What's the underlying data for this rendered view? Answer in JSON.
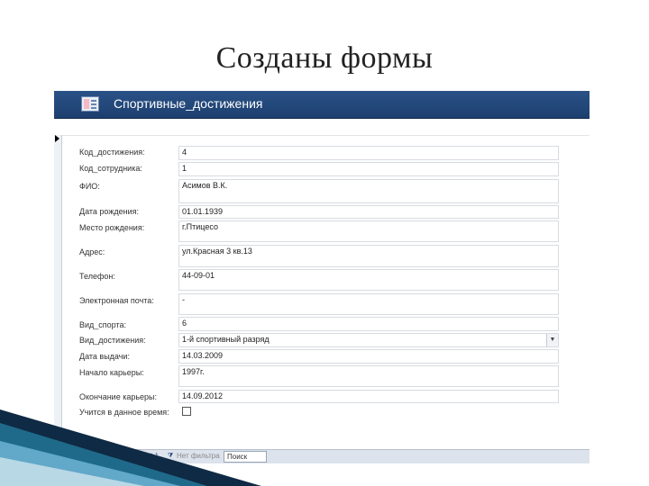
{
  "slide": {
    "title": "Созданы формы"
  },
  "form": {
    "title": "Спортивные_достижения"
  },
  "fields": [
    {
      "label": "Код_достижения:",
      "value": "4"
    },
    {
      "label": "Код_сотрудника:",
      "value": "1"
    },
    {
      "label": "ФИО:",
      "value": "Асимов В.К."
    },
    {
      "label": "Дата рождения:",
      "value": "01.01.1939"
    },
    {
      "label": "Место рождения:",
      "value": "г.Птицесо"
    },
    {
      "label": "Адрес:",
      "value": "ул.Красная 3 кв.13"
    },
    {
      "label": "Телефон:",
      "value": "44-09-01"
    },
    {
      "label": "Электронная почта:",
      "value": "-"
    },
    {
      "label": "Вид_спорта:",
      "value": "6"
    },
    {
      "label": "Вид_достижения:",
      "value": "1-й спортивный разряд"
    },
    {
      "label": "Дата выдачи:",
      "value": "14.03.2009"
    },
    {
      "label": "Начало карьеры:",
      "value": "1997г."
    },
    {
      "label": "Окончание карьеры:",
      "value": "14.09.2012"
    },
    {
      "label": "Учится в данное время:",
      "value": ""
    }
  ],
  "navigator": {
    "record_label": "Запись:",
    "position": "2 из 4",
    "filter_label": "Нет фильтра",
    "search_label": "Поиск",
    "first_icon": "first-record-icon",
    "prev_icon": "previous-record-icon",
    "next_icon": "next-record-icon",
    "last_icon": "last-record-icon",
    "new_icon": "new-record-icon"
  },
  "colors": {
    "header_bg": "#1d3f6f",
    "header_text": "#ffffff",
    "field_border": "#d7dbe1",
    "navbar_bg": "#dde3ec",
    "deco_dark": "#0f2a44",
    "deco_teal": "#1f6a8a",
    "deco_light": "#6fb3d2"
  }
}
